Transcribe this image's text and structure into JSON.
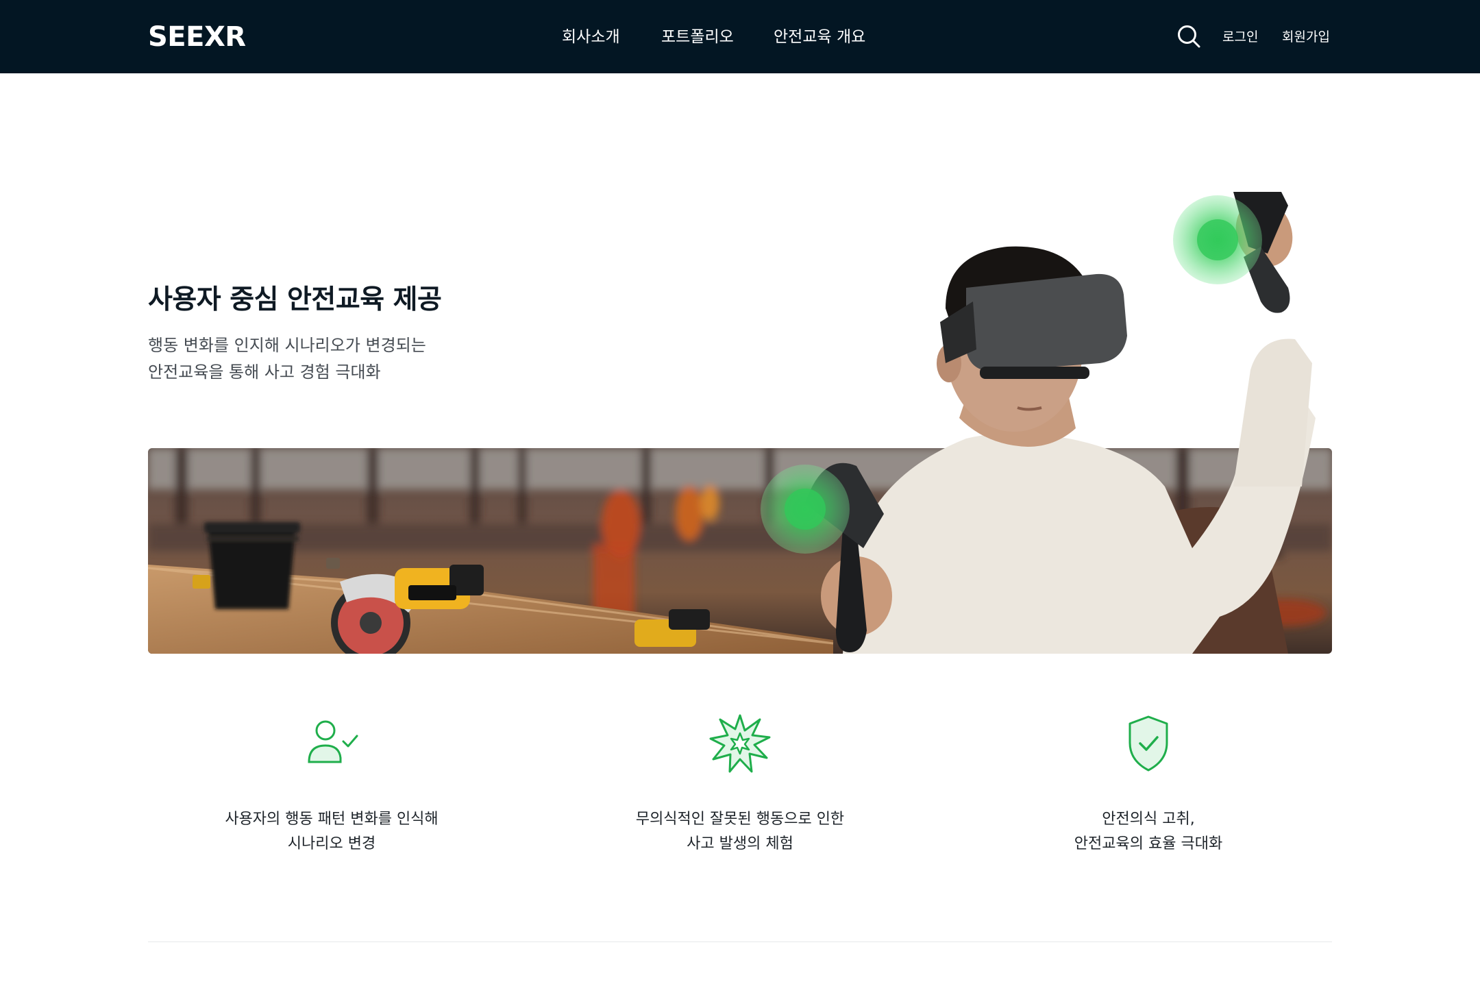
{
  "header": {
    "logo": "SEEXR",
    "nav": [
      "회사소개",
      "포트폴리오",
      "안전교육 개요"
    ],
    "login": "로그인",
    "signup": "회원가입",
    "search_icon": "search-icon"
  },
  "hero": {
    "title": "사용자 중심 안전교육 제공",
    "desc_lines": [
      "행동 변화를 인지해 시나리오가 변경되는",
      "안전교육을 통해 사고 경험 극대화"
    ]
  },
  "features": [
    {
      "icon": "user-check-icon",
      "lines": [
        "사용자의 행동 패턴 변화를 인식해",
        "시나리오 변경"
      ]
    },
    {
      "icon": "explosion-icon",
      "lines": [
        "무의식적인 잘못된 행동으로 인한",
        "사고 발생의 체험"
      ]
    },
    {
      "icon": "shield-check-icon",
      "lines": [
        "안전의식 고취,",
        "안전교육의 효율 극대화"
      ]
    }
  ],
  "colors": {
    "nav_bg": "#031623",
    "accent_green": "#1fae4b",
    "text_dark": "#0f1a24"
  }
}
